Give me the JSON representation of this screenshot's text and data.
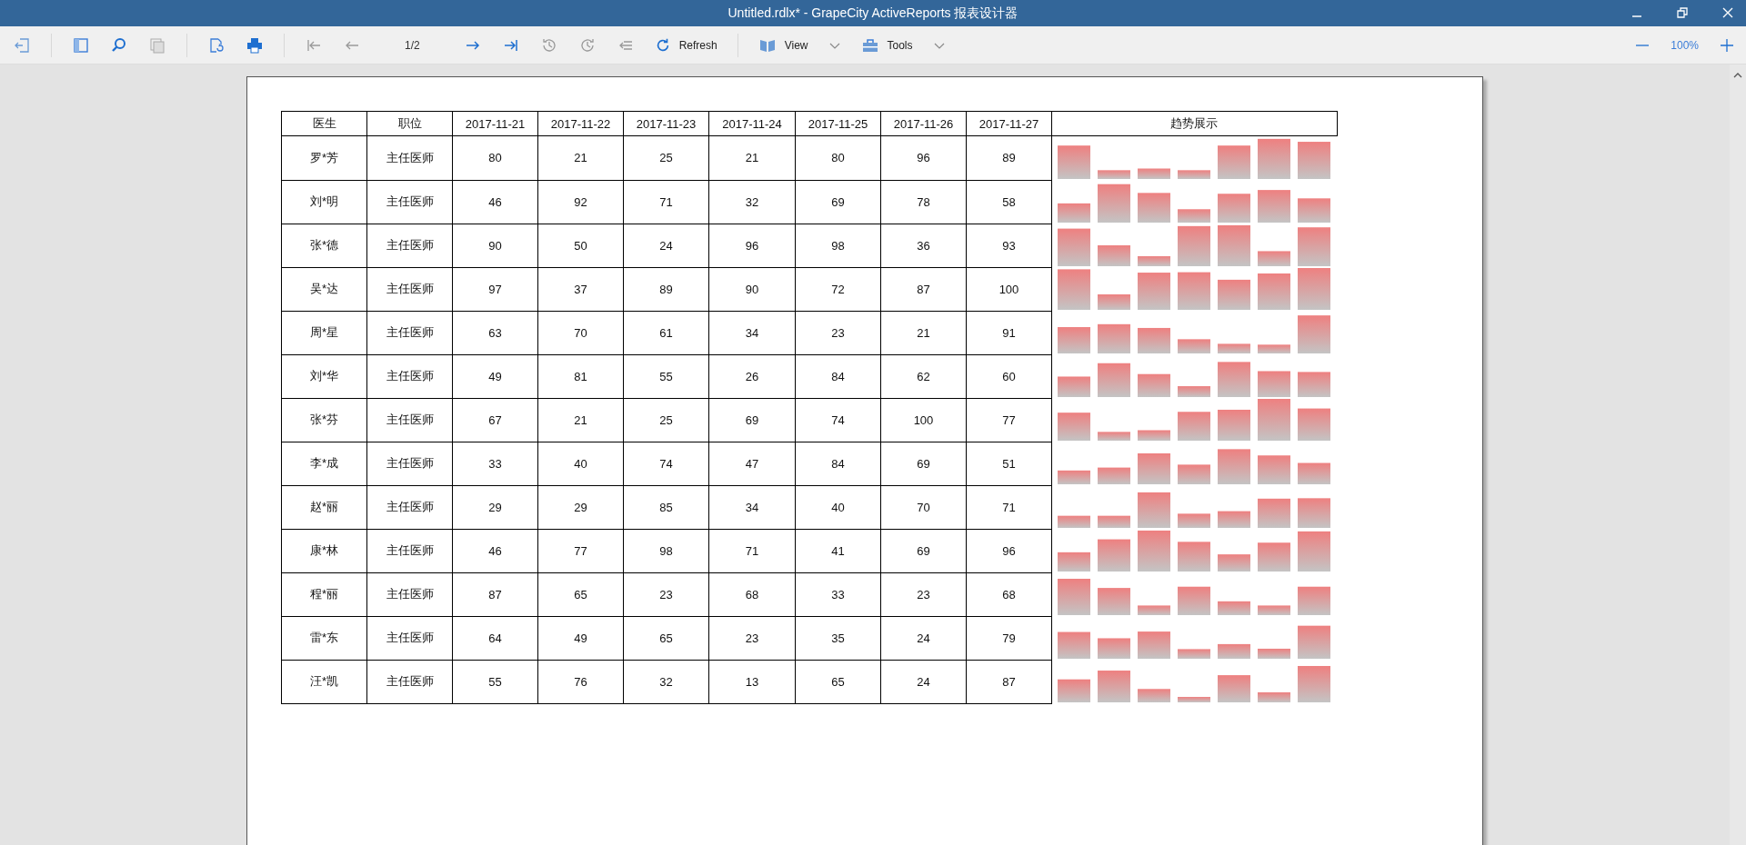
{
  "window": {
    "title": "Untitled.rdlx* - GrapeCity ActiveReports 报表设计器"
  },
  "toolbar": {
    "page": "1/2",
    "refresh": "Refresh",
    "view": "View",
    "tools": "Tools",
    "zoom": "100%"
  },
  "table": {
    "columns": [
      "医生",
      "职位",
      "2017-11-21",
      "2017-11-22",
      "2017-11-23",
      "2017-11-24",
      "2017-11-25",
      "2017-11-26",
      "2017-11-27",
      "趋势展示"
    ],
    "rows": [
      {
        "name": "罗*芳",
        "title": "主任医师",
        "values": [
          "80",
          "21",
          "25",
          "21",
          "80",
          "96",
          "89"
        ]
      },
      {
        "name": "刘*明",
        "title": "主任医师",
        "values": [
          "46",
          "92",
          "71",
          "32",
          "69",
          "78",
          "58"
        ]
      },
      {
        "name": "张*德",
        "title": "主任医师",
        "values": [
          "90",
          "50",
          "24",
          "96",
          "98",
          "36",
          "93"
        ]
      },
      {
        "name": "吴*达",
        "title": "主任医师",
        "values": [
          "97",
          "37",
          "89",
          "90",
          "72",
          "87",
          "100"
        ]
      },
      {
        "name": "周*星",
        "title": "主任医师",
        "values": [
          "63",
          "70",
          "61",
          "34",
          "23",
          "21",
          "91"
        ]
      },
      {
        "name": "刘*华",
        "title": "主任医师",
        "values": [
          "49",
          "81",
          "55",
          "26",
          "84",
          "62",
          "60"
        ]
      },
      {
        "name": "张*芬",
        "title": "主任医师",
        "values": [
          "67",
          "21",
          "25",
          "69",
          "74",
          "100",
          "77"
        ]
      },
      {
        "name": "李*成",
        "title": "主任医师",
        "values": [
          "33",
          "40",
          "74",
          "47",
          "84",
          "69",
          "51"
        ]
      },
      {
        "name": "赵*丽",
        "title": "主任医师",
        "values": [
          "29",
          "29",
          "85",
          "34",
          "40",
          "70",
          "71"
        ]
      },
      {
        "name": "康*林",
        "title": "主任医师",
        "values": [
          "46",
          "77",
          "98",
          "71",
          "41",
          "69",
          "96"
        ]
      },
      {
        "name": "程*丽",
        "title": "主任医师",
        "values": [
          "87",
          "65",
          "23",
          "68",
          "33",
          "23",
          "68"
        ]
      },
      {
        "name": "雷*东",
        "title": "主任医师",
        "values": [
          "64",
          "49",
          "65",
          "23",
          "35",
          "24",
          "79"
        ]
      },
      {
        "name": "汪*凯",
        "title": "主任医师",
        "values": [
          "55",
          "76",
          "32",
          "13",
          "65",
          "24",
          "87"
        ]
      }
    ]
  }
}
